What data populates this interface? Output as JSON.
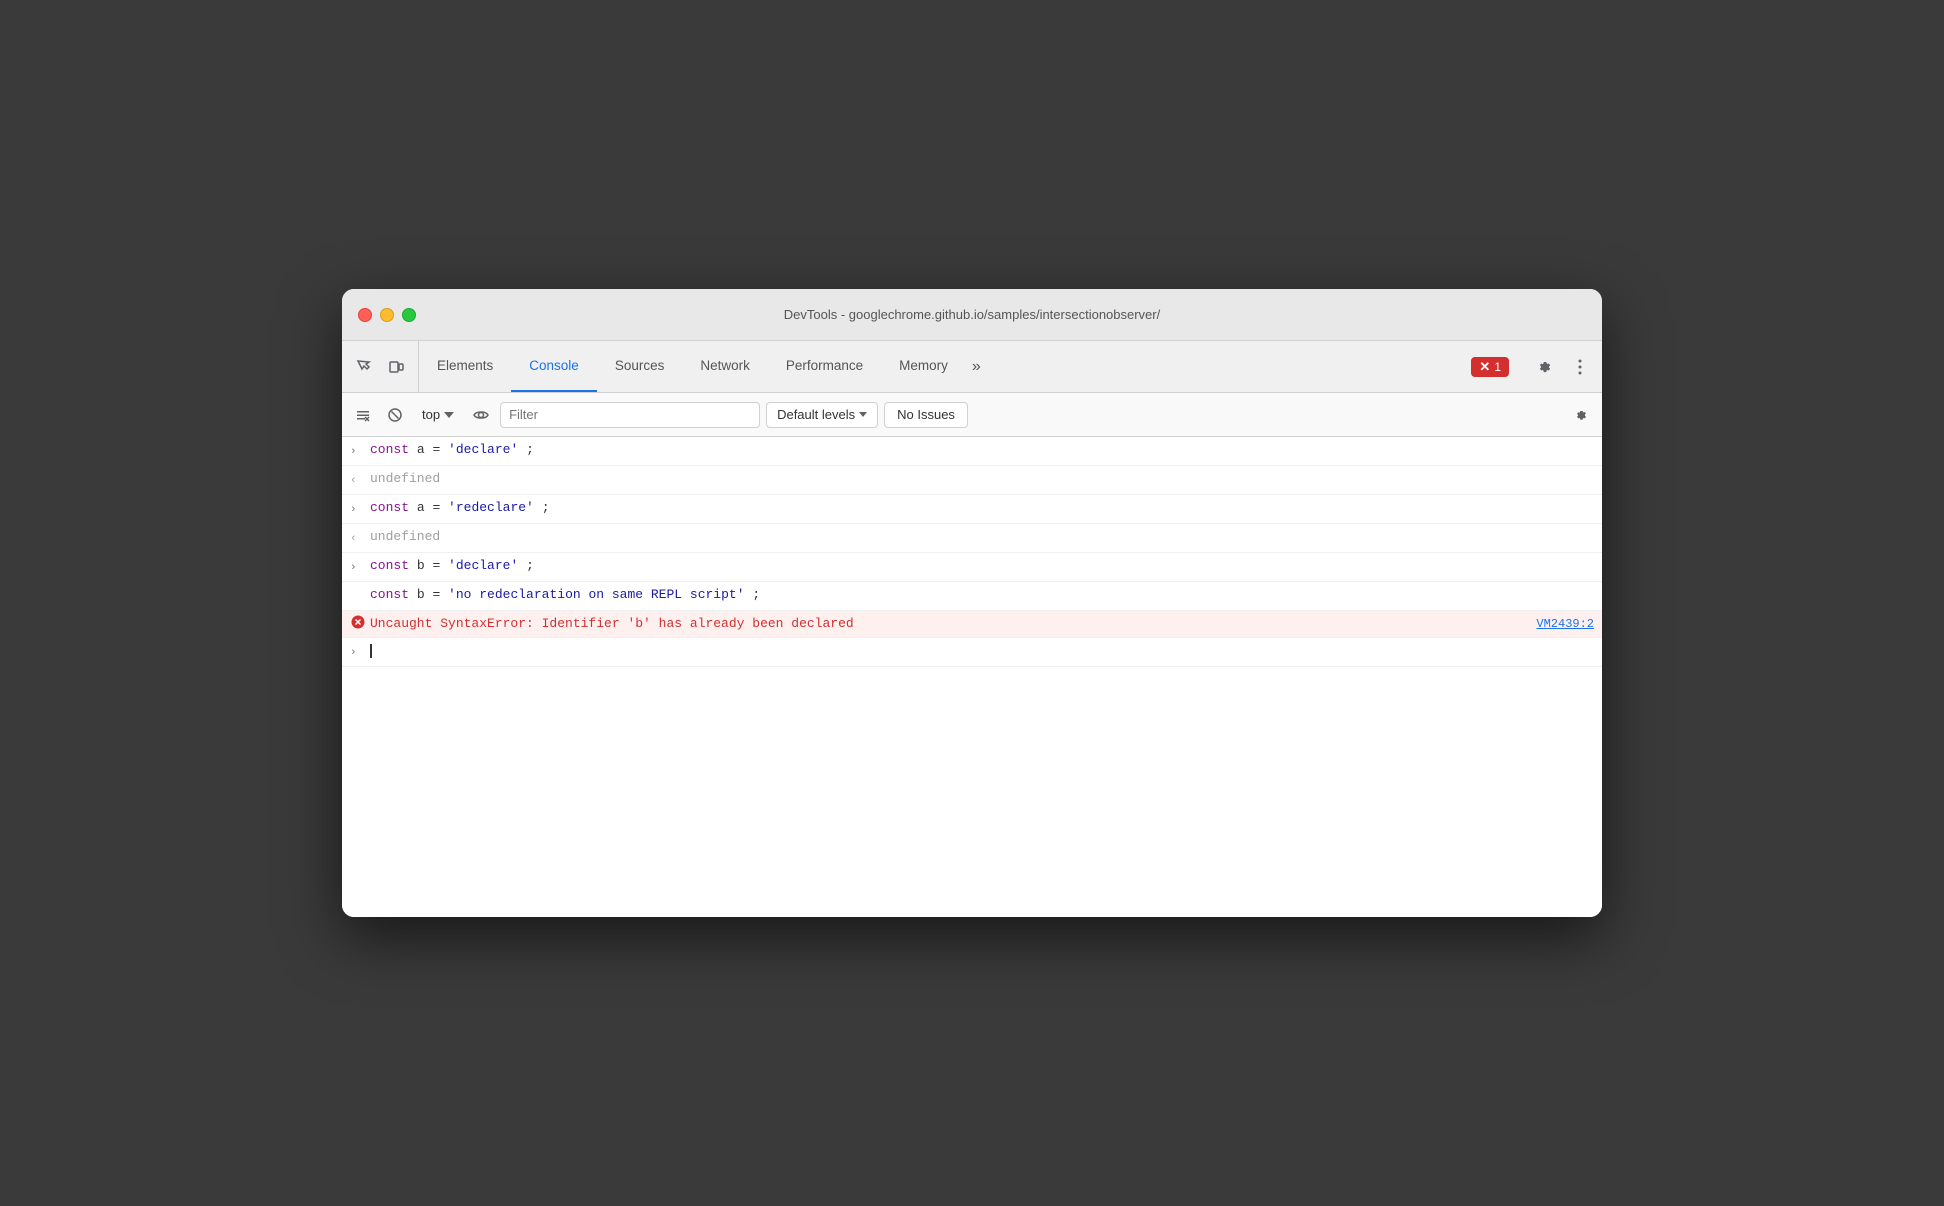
{
  "window": {
    "title": "DevTools - googlechrome.github.io/samples/intersectionobserver/"
  },
  "toolbar": {
    "tabs": [
      {
        "id": "elements",
        "label": "Elements",
        "active": false
      },
      {
        "id": "console",
        "label": "Console",
        "active": true
      },
      {
        "id": "sources",
        "label": "Sources",
        "active": false
      },
      {
        "id": "network",
        "label": "Network",
        "active": false
      },
      {
        "id": "performance",
        "label": "Performance",
        "active": false
      },
      {
        "id": "memory",
        "label": "Memory",
        "active": false
      }
    ],
    "error_count": "1",
    "more_tabs": "»"
  },
  "console_toolbar": {
    "context": "top",
    "filter_placeholder": "Filter",
    "levels_label": "Default levels",
    "no_issues_label": "No Issues"
  },
  "console_output": {
    "lines": [
      {
        "type": "input",
        "chevron": "›",
        "code": "const a = 'declare';"
      },
      {
        "type": "output",
        "chevron": "‹",
        "text": "undefined"
      },
      {
        "type": "input",
        "chevron": "›",
        "code": "const a = 'redeclare';"
      },
      {
        "type": "output",
        "chevron": "‹",
        "text": "undefined"
      },
      {
        "type": "input",
        "chevron": "›",
        "code_line1": "const b = 'declare';",
        "code_line2": "const b = 'no redeclaration on same REPL script';"
      },
      {
        "type": "error",
        "message": "Uncaught SyntaxError: Identifier 'b' has already been declared",
        "source": "VM2439:2"
      },
      {
        "type": "prompt",
        "chevron": "›"
      }
    ]
  }
}
